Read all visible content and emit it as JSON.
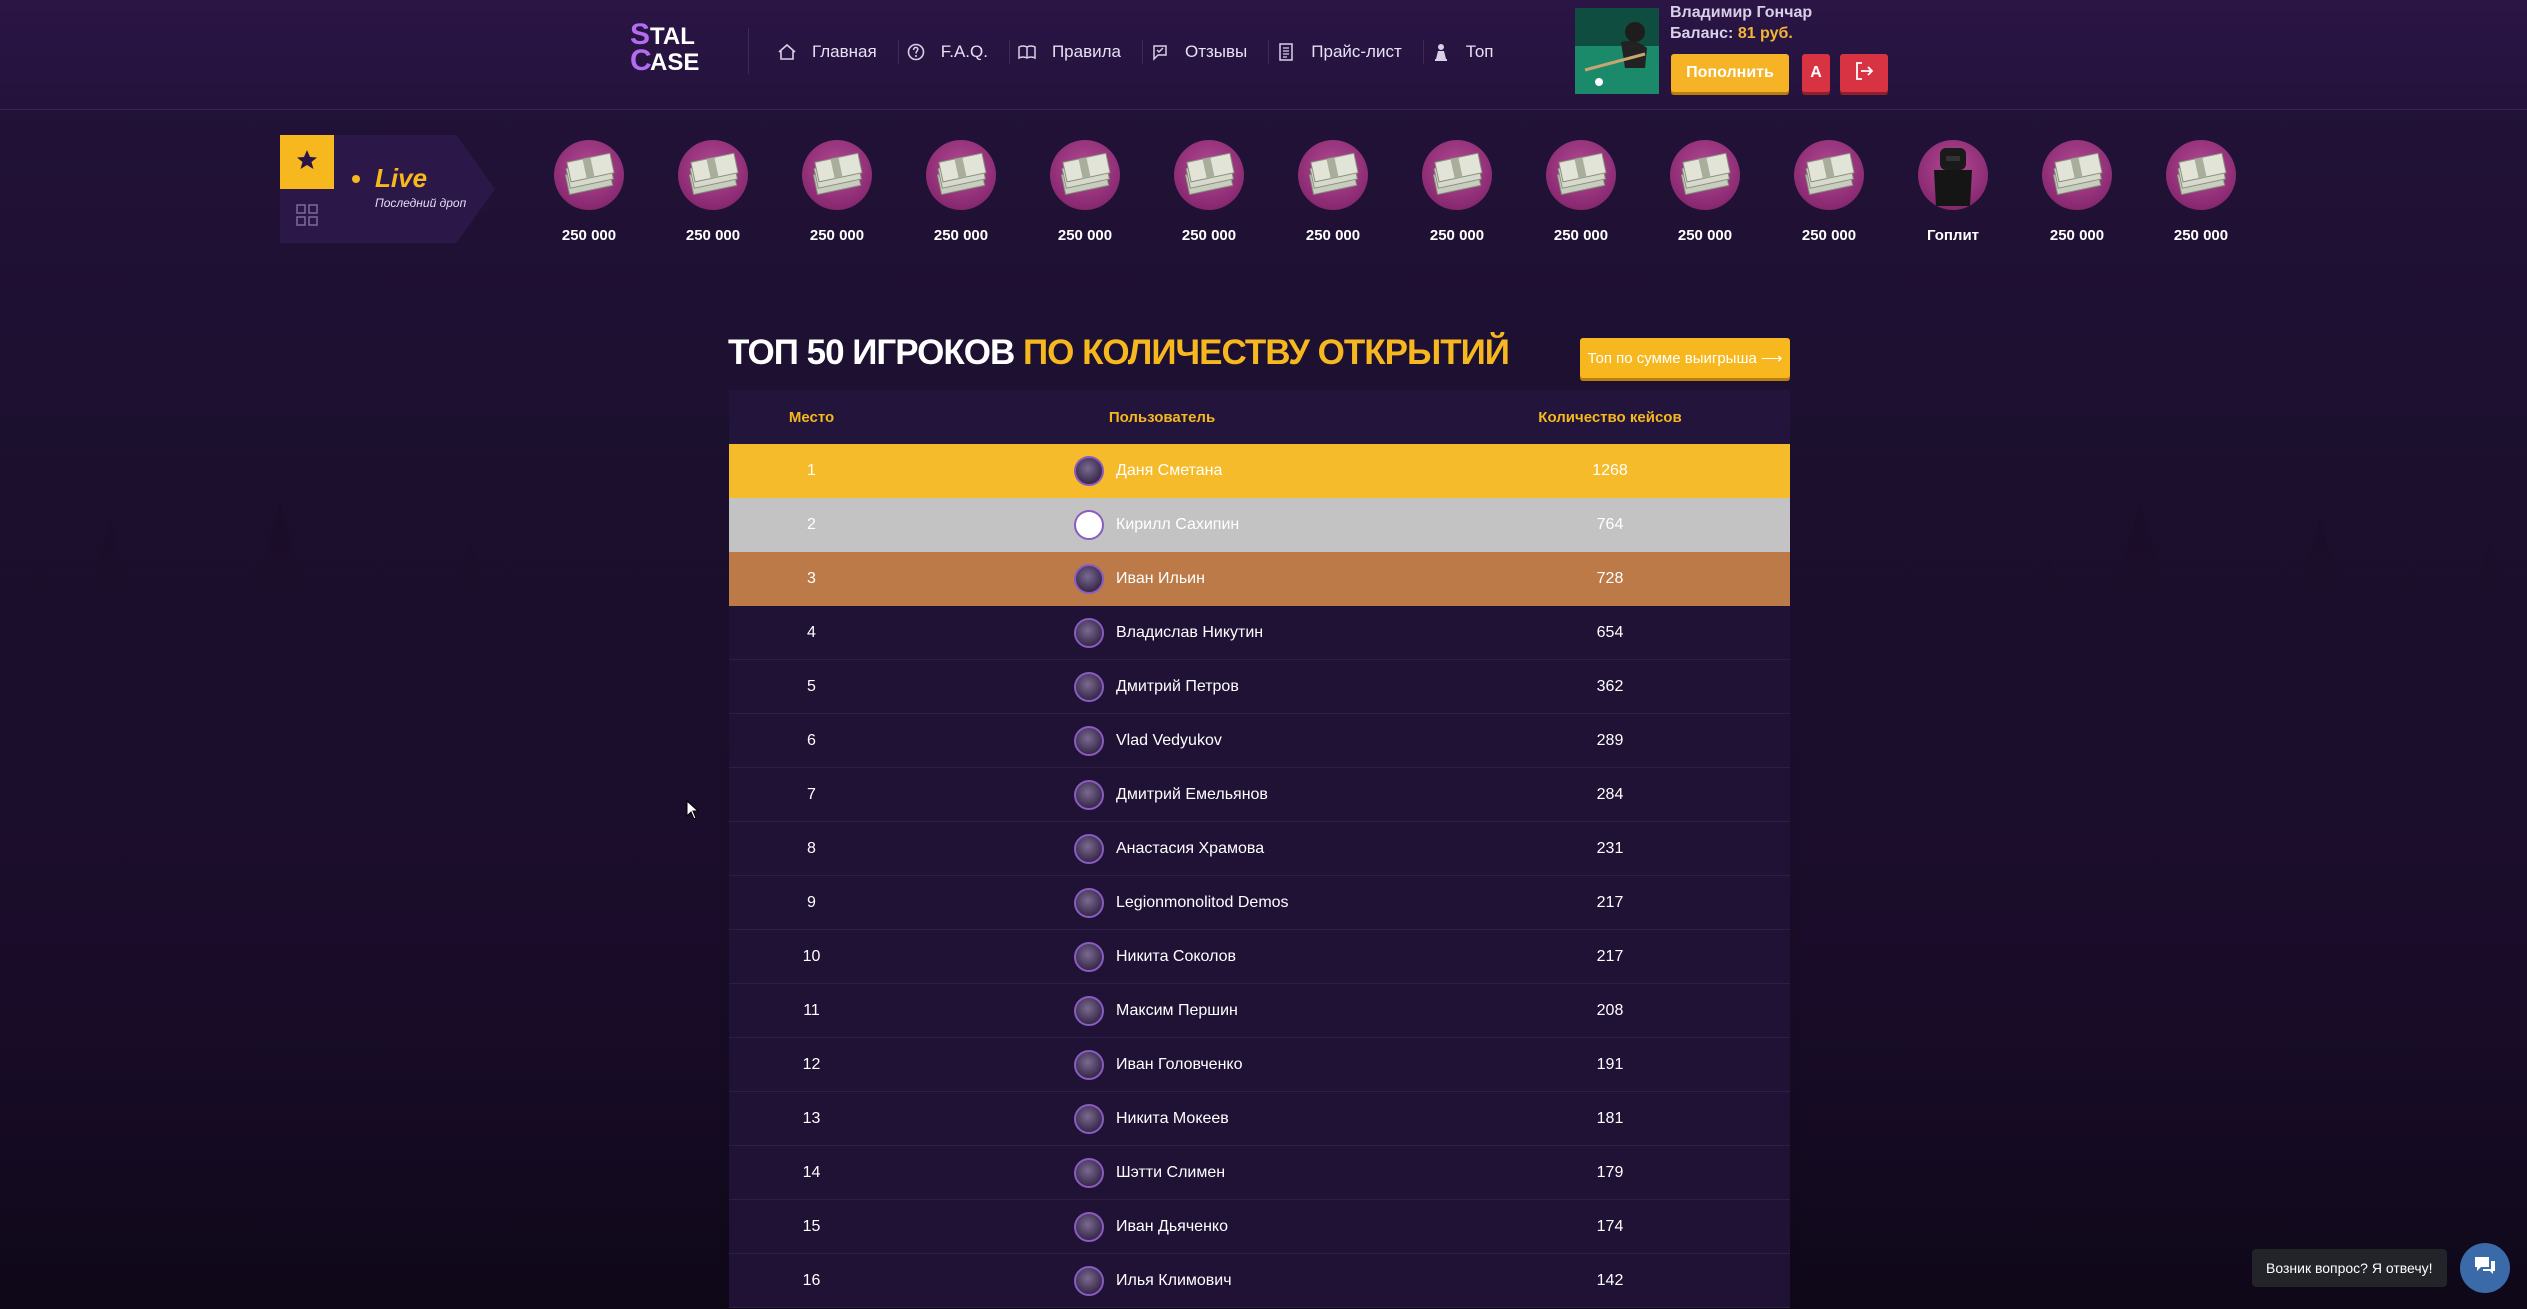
{
  "header": {
    "logo": {
      "line1": "STAL",
      "line2": "CASE"
    },
    "nav": [
      {
        "label": "Главная",
        "icon": "home-icon"
      },
      {
        "label": "F.A.Q.",
        "icon": "question-icon"
      },
      {
        "label": "Правила",
        "icon": "book-icon"
      },
      {
        "label": "Отзывы",
        "icon": "review-icon"
      },
      {
        "label": "Прайс-лист",
        "icon": "pricelist-icon"
      },
      {
        "label": "Топ",
        "icon": "trophy-icon"
      }
    ],
    "user": {
      "name": "Владимир Гончар",
      "balance_label": "Баланс:",
      "balance_value": "81 руб."
    },
    "topup_label": "Пополнить",
    "admin_label": "A"
  },
  "live": {
    "title": "Live",
    "subtitle": "Последний дроп",
    "drops": [
      {
        "label": "250 000",
        "kind": "money"
      },
      {
        "label": "250 000",
        "kind": "money"
      },
      {
        "label": "250 000",
        "kind": "money"
      },
      {
        "label": "250 000",
        "kind": "money"
      },
      {
        "label": "250 000",
        "kind": "money"
      },
      {
        "label": "250 000",
        "kind": "money"
      },
      {
        "label": "250 000",
        "kind": "money"
      },
      {
        "label": "250 000",
        "kind": "money"
      },
      {
        "label": "250 000",
        "kind": "money"
      },
      {
        "label": "250 000",
        "kind": "money"
      },
      {
        "label": "250 000",
        "kind": "money"
      },
      {
        "label": "Гоплит",
        "kind": "armor"
      },
      {
        "label": "250 000",
        "kind": "money"
      },
      {
        "label": "250 000",
        "kind": "money"
      }
    ]
  },
  "leaderboard": {
    "title_white": "Топ 50 игроков",
    "title_yellow": "по количеству открытий",
    "switch_button": "Топ по сумме выигрыша ⟶",
    "columns": [
      "Место",
      "Пользователь",
      "Количество кейсов"
    ],
    "rows": [
      {
        "place": "1",
        "user": "Даня Сметана",
        "count": "1268"
      },
      {
        "place": "2",
        "user": "Кирилл Сахипин",
        "count": "764"
      },
      {
        "place": "3",
        "user": "Иван Ильин",
        "count": "728"
      },
      {
        "place": "4",
        "user": "Владислав Никутин",
        "count": "654"
      },
      {
        "place": "5",
        "user": "Дмитрий Петров",
        "count": "362"
      },
      {
        "place": "6",
        "user": "Vlad Vedyukov",
        "count": "289"
      },
      {
        "place": "7",
        "user": "Дмитрий Емельянов",
        "count": "284"
      },
      {
        "place": "8",
        "user": "Анастасия Храмова",
        "count": "231"
      },
      {
        "place": "9",
        "user": "Legionmonolitod Demos",
        "count": "217"
      },
      {
        "place": "10",
        "user": "Никита Соколов",
        "count": "217"
      },
      {
        "place": "11",
        "user": "Максим Першин",
        "count": "208"
      },
      {
        "place": "12",
        "user": "Иван Головченко",
        "count": "191"
      },
      {
        "place": "13",
        "user": "Никита Мокеев",
        "count": "181"
      },
      {
        "place": "14",
        "user": "Шэтти Слимен",
        "count": "179"
      },
      {
        "place": "15",
        "user": "Иван Дьяченко",
        "count": "174"
      },
      {
        "place": "16",
        "user": "Илья Климович",
        "count": "142"
      }
    ]
  },
  "chat": {
    "prompt": "Возник вопрос? Я отвечу!"
  },
  "colors": {
    "accent": "#f6b81e",
    "danger": "#d83342",
    "bg": "#1a0f2b",
    "gold": "#f6bb2a",
    "silver": "#c3c3c3",
    "bronze": "#bb7a48"
  }
}
